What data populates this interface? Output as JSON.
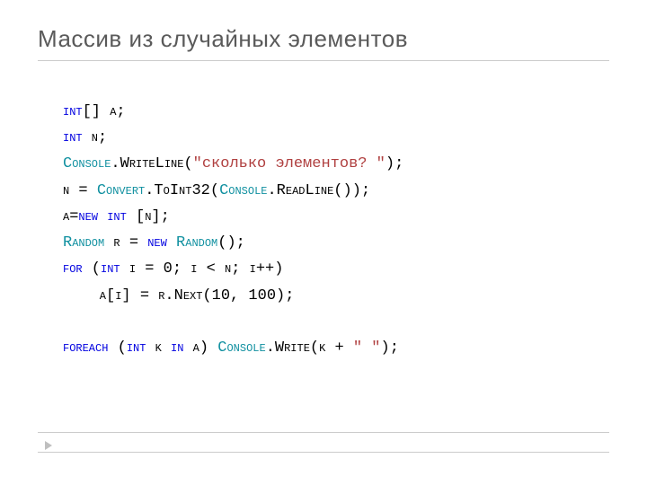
{
  "title": "Массив из случайных элементов",
  "code": {
    "l1": {
      "kw": "int",
      "rest": "[] a;"
    },
    "l2": {
      "kw": "int",
      "rest": " n;"
    },
    "l3": {
      "typ": "Console",
      "method": ".WriteLine(",
      "str": "\"сколько элементов? \"",
      "close": ");"
    },
    "l4": {
      "lhs": "n = ",
      "typ1": "Convert",
      "m1": ".ToInt32(",
      "typ2": "Console",
      "m2": ".ReadLine());"
    },
    "l5": {
      "lhs": "a=",
      "kw1": "new",
      "sp": " ",
      "kw2": "int",
      "rest": " [n];"
    },
    "l6": {
      "typ": "Random",
      "mid": " r = ",
      "kw": "new",
      "typ2": " Random",
      "rest": "();"
    },
    "l7": {
      "kw1": "for",
      "open": " (",
      "kw2": "int",
      "rest": " i = 0; i < n; i++)"
    },
    "l8": {
      "indent": "    a[i] = r.Next(10, 100);"
    },
    "l9": {
      "kw1": "foreach",
      "open": " (",
      "kw2": "int",
      "mid": " k ",
      "kw3": "in",
      "rest": " a) ",
      "typ": "Console",
      "m": ".Write(k + ",
      "str": "\" \"",
      "close": ");"
    }
  }
}
